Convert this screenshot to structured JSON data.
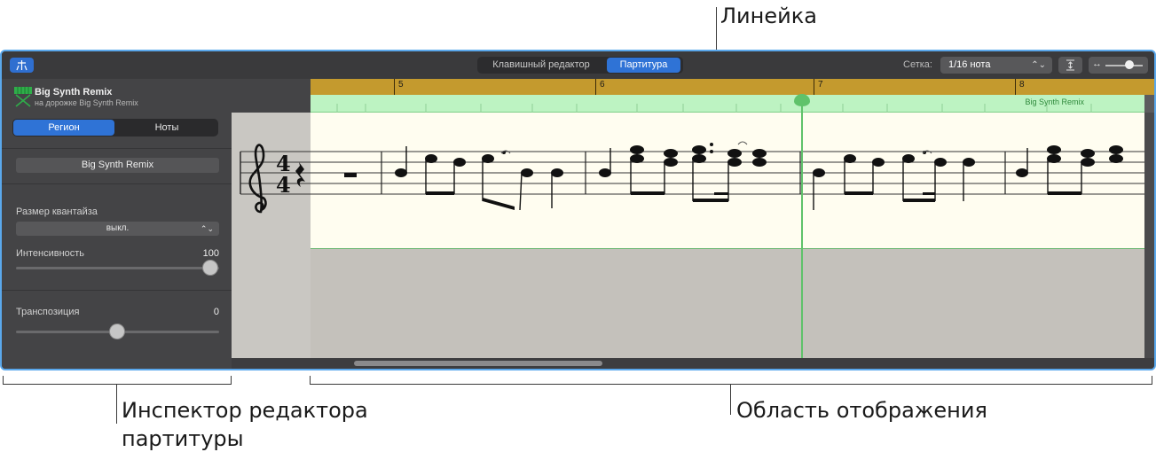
{
  "callouts": {
    "ruler": "Линейка",
    "inspector_line1": "Инспектор редактора",
    "inspector_line2": "партитуры",
    "display": "Область отображения"
  },
  "toolbar": {
    "smart_controls_icon": "smart-controls-icon",
    "mode_piano": "Клавишный редактор",
    "mode_score": "Партитура",
    "grid_label": "Сетка:",
    "grid_value": "1/16 нота",
    "zoom_icon": "↔"
  },
  "inspector": {
    "track_title": "Big Synth Remix",
    "track_subtitle": "на дорожке Big Synth Remix",
    "tab_region": "Регион",
    "tab_notes": "Ноты",
    "region_name": "Big Synth Remix",
    "quantize_label": "Размер квантайза",
    "quantize_value": "выкл.",
    "velocity_label": "Интенсивность",
    "velocity_value": "100",
    "velocity_level": 1.0,
    "transpose_label": "Транспозиция",
    "transpose_value": "0",
    "transpose_level": 0.5
  },
  "display": {
    "bars": [
      "5",
      "6",
      "7",
      "8"
    ],
    "region_label": "Big Synth Remix",
    "time_signature": "4/4",
    "clef": "treble"
  },
  "colors": {
    "accent": "#2f73d6",
    "ruler": "#c49a2e",
    "region": "#bdf3c2",
    "playhead": "#5fc26a",
    "callout_line": "#5aa8ec"
  }
}
